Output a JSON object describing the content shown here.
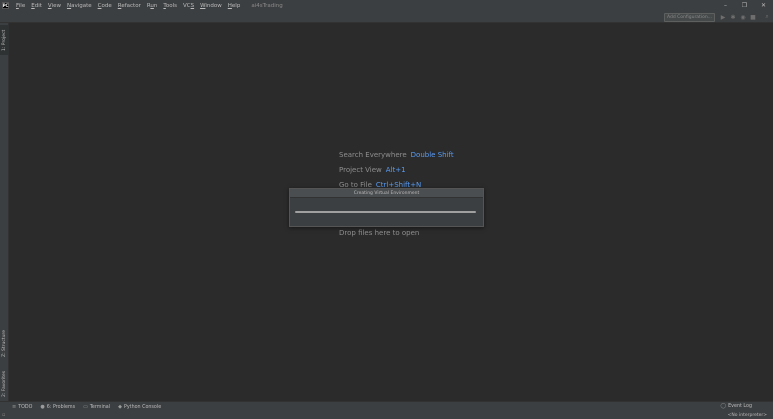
{
  "app": {
    "logo_text": "PC",
    "project_name": "ai4sTrading"
  },
  "menu": [
    {
      "prefix": "",
      "u": "F",
      "rest": "ile"
    },
    {
      "prefix": "",
      "u": "E",
      "rest": "dit"
    },
    {
      "prefix": "",
      "u": "V",
      "rest": "iew"
    },
    {
      "prefix": "",
      "u": "N",
      "rest": "avigate"
    },
    {
      "prefix": "",
      "u": "C",
      "rest": "ode"
    },
    {
      "prefix": "",
      "u": "R",
      "rest": "efactor"
    },
    {
      "prefix": "R",
      "u": "u",
      "rest": "n"
    },
    {
      "prefix": "",
      "u": "T",
      "rest": "ools"
    },
    {
      "prefix": "VC",
      "u": "S",
      "rest": ""
    },
    {
      "prefix": "",
      "u": "W",
      "rest": "indow"
    },
    {
      "prefix": "",
      "u": "H",
      "rest": "elp"
    }
  ],
  "window_controls": {
    "minimize": "–",
    "restore": "❐",
    "close": "✕"
  },
  "toolbar": {
    "add_config_label": "Add Configuration...",
    "icons": {
      "run": "▶",
      "debug": "✱",
      "coverage": "◉",
      "stop": "■",
      "search": "⌕"
    }
  },
  "left_strip": {
    "project": "1: Project",
    "structure": "Z: Structure",
    "favorites": "2: Favorites"
  },
  "hints": {
    "search_everywhere": {
      "label": "Search Everywhere",
      "shortcut": "Double Shift"
    },
    "project_view": {
      "label": "Project View",
      "shortcut": "Alt+1"
    },
    "go_to_file": {
      "label": "Go to File",
      "shortcut": "Ctrl+Shift+N"
    },
    "drop_files": {
      "label": "Drop files here to open"
    }
  },
  "dialog": {
    "title": "Creating Virtual Environment",
    "progress": 1.0
  },
  "bottom_tabs": [
    {
      "icon": "≡",
      "label": "TODO"
    },
    {
      "icon": "●",
      "label": "6: Problems"
    },
    {
      "icon": "▭",
      "label": "Terminal"
    },
    {
      "icon": "◆",
      "label": "Python Console"
    }
  ],
  "event_log": {
    "icon": "◯",
    "label": "Event Log"
  },
  "status": {
    "interpreter": "<No interpreter>"
  }
}
